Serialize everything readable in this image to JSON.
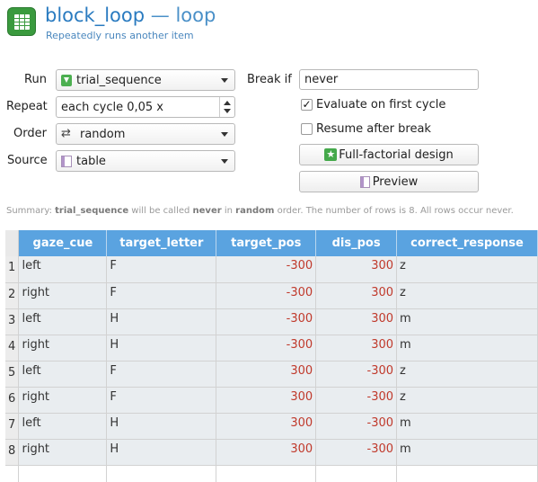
{
  "header": {
    "name": "block_loop",
    "type_sep": " — ",
    "type": "loop",
    "subtitle": "Repeatedly runs another item"
  },
  "form": {
    "run": {
      "label": "Run",
      "value": "trial_sequence"
    },
    "repeat": {
      "label": "Repeat",
      "value": "each cycle 0,05 x"
    },
    "order": {
      "label": "Order",
      "value": "random"
    },
    "source": {
      "label": "Source",
      "value": "table"
    },
    "break_if": {
      "label": "Break if",
      "value": "never"
    },
    "evaluate_first": {
      "label": "Evaluate on first cycle",
      "checked": true
    },
    "resume_after_break": {
      "label": "Resume after break",
      "checked": false
    },
    "full_factorial_label": "Full-factorial design",
    "preview_label": "Preview"
  },
  "summary": {
    "prefix": "Summary: ",
    "item": "trial_sequence",
    "mid1": " will be called ",
    "count": "never",
    "mid2": " in ",
    "order": "random",
    "suffix": " order. The number of rows is 8. All rows occur never."
  },
  "table": {
    "columns": [
      "gaze_cue",
      "target_letter",
      "target_pos",
      "dis_pos",
      "correct_response"
    ],
    "rows": [
      [
        "left",
        "F",
        "-300",
        "300",
        "z"
      ],
      [
        "right",
        "F",
        "-300",
        "300",
        "z"
      ],
      [
        "left",
        "H",
        "-300",
        "300",
        "m"
      ],
      [
        "right",
        "H",
        "-300",
        "300",
        "m"
      ],
      [
        "left",
        "F",
        "300",
        "-300",
        "z"
      ],
      [
        "right",
        "F",
        "300",
        "-300",
        "z"
      ],
      [
        "left",
        "H",
        "300",
        "-300",
        "m"
      ],
      [
        "right",
        "H",
        "300",
        "-300",
        "m"
      ]
    ]
  },
  "icons": {
    "header": "loop-table-icon",
    "run": "arrow-down-icon",
    "order": "shuffle-icon",
    "source": "table-icon",
    "full_factorial": "star-icon",
    "preview": "preview-icon"
  },
  "colors": {
    "accent": "#2a7bc0",
    "header_bg": "#5aa3e0",
    "number": "#c0392b",
    "cell_bg": "#e9edf0"
  }
}
